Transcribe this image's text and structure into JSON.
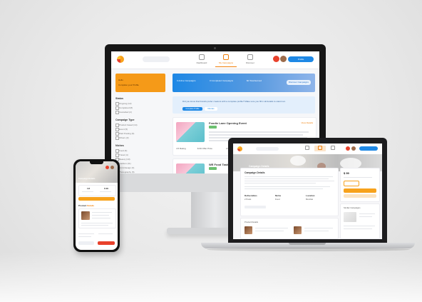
{
  "imac": {
    "nav": [
      {
        "label": "Dashboard",
        "active": false
      },
      {
        "label": "My Campaigns",
        "active": true
      },
      {
        "label": "Discover",
        "active": false
      }
    ],
    "profile_label": "Profile",
    "sidebar_card": {
      "line1": "Hello",
      "line2": "Complete your Profile"
    },
    "hero_stats": [
      "0",
      "Active Campaigns",
      "0",
      "Completed Campaigns",
      "$0",
      "Total Earned"
    ],
    "hero_button": "Discover Campaigns",
    "filters": [
      {
        "heading": "Status",
        "items": [
          "Ongoing (12)",
          "Completed (8)",
          "Cancelled (2)"
        ]
      },
      {
        "heading": "Campaign Type",
        "items": [
          "Product based (14)",
          "Event (5)",
          "Paid Posting (9)",
          "Others (3)"
        ]
      },
      {
        "heading": "Niches",
        "items": [
          "Food (6)",
          "Travel (4)",
          "Beauty (10)",
          "Fashion (11)",
          "Art & Design (3)",
          "Photography (5)"
        ]
      }
    ],
    "banner": {
      "text": "Did you know that brands prefer creators with a complete profile? Make sure you fill in all details to stand out.",
      "primary": "Complete Profile",
      "secondary": "Dismiss"
    },
    "cards": [
      {
        "title": "Foodie Lane Opening Event",
        "link": "View Details",
        "meta": [
          "4.5 Rating",
          "$ 99 Offer Price",
          "2 Deliverables"
        ]
      },
      {
        "title": "WE Food Tasting Pr...",
        "link": "View Details",
        "meta": []
      }
    ]
  },
  "laptop": {
    "hero_title": "Campaign Details",
    "panel_heading": "Campaign Details",
    "panel_fields": [
      {
        "label": "Deliverables",
        "value": "2 Posts"
      },
      {
        "label": "Niche",
        "value": "Food"
      },
      {
        "label": "Location",
        "value": "Mumbai"
      }
    ],
    "price": "$ 99",
    "bottom_heading": "Product Details",
    "right_heading": "Similar Campaigns"
  },
  "phone": {
    "hero_title": "Campaign Details",
    "stats": [
      "4.8",
      "$ 99"
    ],
    "section_label": "Product",
    "section_accent": "Details"
  }
}
